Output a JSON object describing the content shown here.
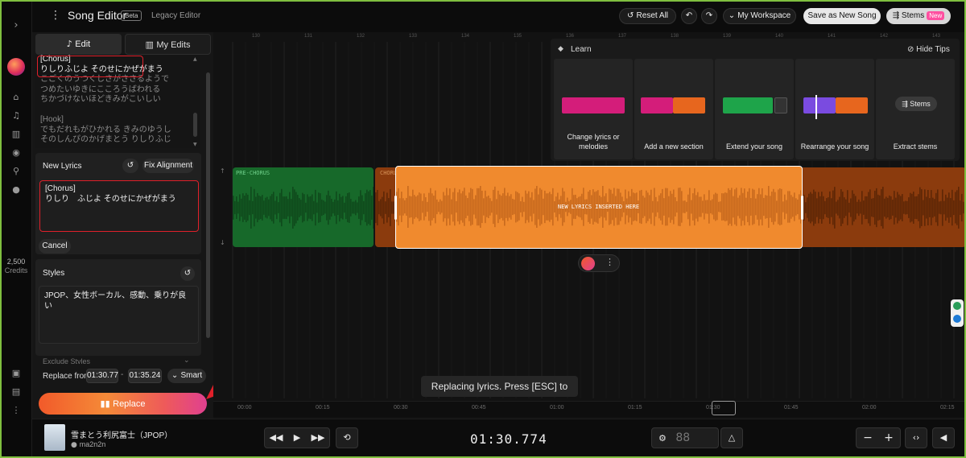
{
  "header": {
    "title": "Song Editor",
    "badge": "Beta",
    "legacy_link": "Legacy Editor",
    "reset_all": "Reset All",
    "workspace": "My Workspace",
    "save_new": "Save as New Song",
    "stems": "Stems",
    "stems_badge": "New"
  },
  "sidebar": {
    "credits_value": "2,500",
    "credits_label": "Credits"
  },
  "panel": {
    "tab_edit": "Edit",
    "tab_my_edits": "My Edits",
    "lyrics_lines": [
      {
        "text": "[Chorus]",
        "highlight": true
      },
      {
        "text": "りしりふじよ そのせにかぜがまう",
        "highlight": true
      },
      {
        "text": "こごくのうつくしさがささるようで",
        "highlight": false
      },
      {
        "text": "つめたいゆきにこころうばわれる",
        "highlight": false
      },
      {
        "text": "ちかづけないほどきみがこいしい",
        "highlight": false
      },
      {
        "text": "",
        "highlight": false
      },
      {
        "text": "[Hook]",
        "highlight": false
      },
      {
        "text": "でもだれもがひかれる きみのゆうし",
        "highlight": false
      },
      {
        "text": "そのしんぴのかげまとう りしりふじ",
        "highlight": false
      }
    ],
    "new_lyrics_label": "New Lyrics",
    "fix_alignment": "Fix Alignment",
    "new_lyrics_line1": "[Chorus]",
    "new_lyrics_line2": "りしり　ふじよ そのせにかぜがまう",
    "cancel": "Cancel",
    "styles_label": "Styles",
    "styles_value": "JPOP、女性ボーカル、感動、乗りが良い",
    "exclude_styles": "Exclude Styles",
    "replace_from_label": "Replace from",
    "range_start": "01:30.77",
    "range_sep": "-",
    "range_end": "01:35.24",
    "smart": "Smart",
    "replace_button": "Replace"
  },
  "tips": {
    "learn": "Learn",
    "hide": "Hide Tips",
    "cards": [
      {
        "label": "Change lyrics or melodies"
      },
      {
        "label": "Add a new section"
      },
      {
        "label": "Extend your song"
      },
      {
        "label": "Rearrange your song"
      },
      {
        "label": "Extract stems",
        "button": "Stems"
      }
    ]
  },
  "ruler_marks": [
    "130",
    "131",
    "132",
    "133",
    "134",
    "135",
    "136",
    "137",
    "138",
    "139",
    "140",
    "141",
    "142",
    "143"
  ],
  "tracks": {
    "pre_chorus": "PRE-CHORUS",
    "chorus": "CHORUS",
    "inserted": "NEW LYRICS INSERTED HERE"
  },
  "toast": "Replacing lyrics. Press [ESC] to stop.",
  "time_ticks": [
    "00:00",
    "00:15",
    "00:30",
    "00:45",
    "01:00",
    "01:15",
    "01:30",
    "01:45",
    "02:00",
    "02:15"
  ],
  "player": {
    "song_title": "雪まとう利尻富士（JPOP）",
    "artist": "ma2n2n",
    "clock": "01:30.774",
    "bpm": "88"
  },
  "colors": {
    "pre_chorus": "#17692a",
    "chorus": "#8b3b0d",
    "selected": "#f08a2e",
    "accent_red": "#e0202a"
  }
}
